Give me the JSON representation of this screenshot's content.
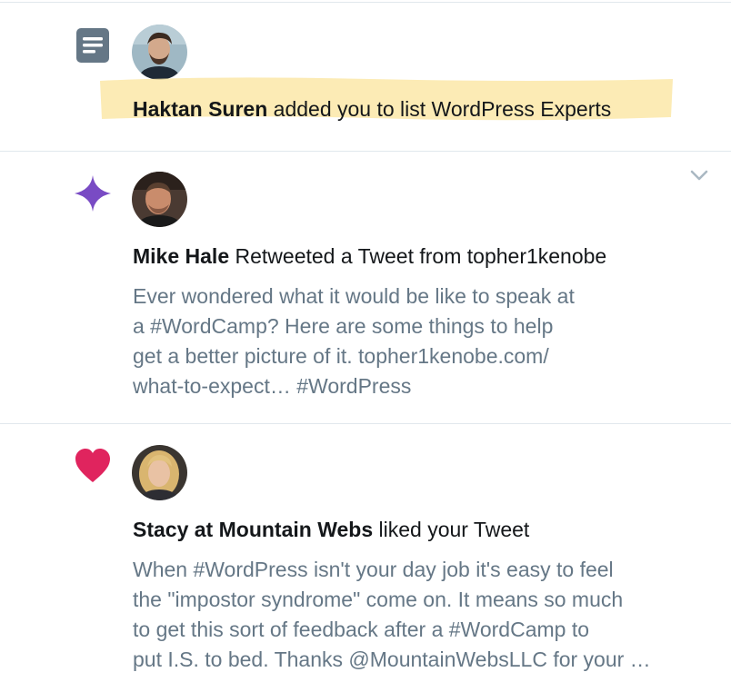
{
  "notifications": [
    {
      "type": "list",
      "icon": "list-icon",
      "actor": "Haktan Suren",
      "action": " added you to list WordPress Experts",
      "highlight_color": "#fbe7a8"
    },
    {
      "type": "retweet-recommendation",
      "icon": "sparkle-icon",
      "actor": "Mike Hale",
      "action": " Retweeted a Tweet from topher1kenobe",
      "body_lines": [
        "Ever wondered what it would be like to speak at",
        "a #WordCamp? Here are some things to help",
        "get a better picture of it. topher1kenobe.com/",
        "what-to-expect… #WordPress"
      ]
    },
    {
      "type": "like",
      "icon": "heart-icon",
      "actor": "Stacy at Mountain Webs",
      "action": " liked your Tweet",
      "body_lines": [
        "When #WordPress isn't your day job it's easy to feel",
        "the \"impostor syndrome\" come on. It means so much",
        "to get this sort of feedback after a #WordCamp to",
        "put I.S. to bed. Thanks @MountainWebsLLC for your …"
      ]
    }
  ],
  "colors": {
    "list_icon": "#657786",
    "sparkle_icon": "#794bc4",
    "heart_icon": "#e0245e",
    "caret": "#aab8c2",
    "body_text": "#657786",
    "headline_text": "#14171a"
  }
}
